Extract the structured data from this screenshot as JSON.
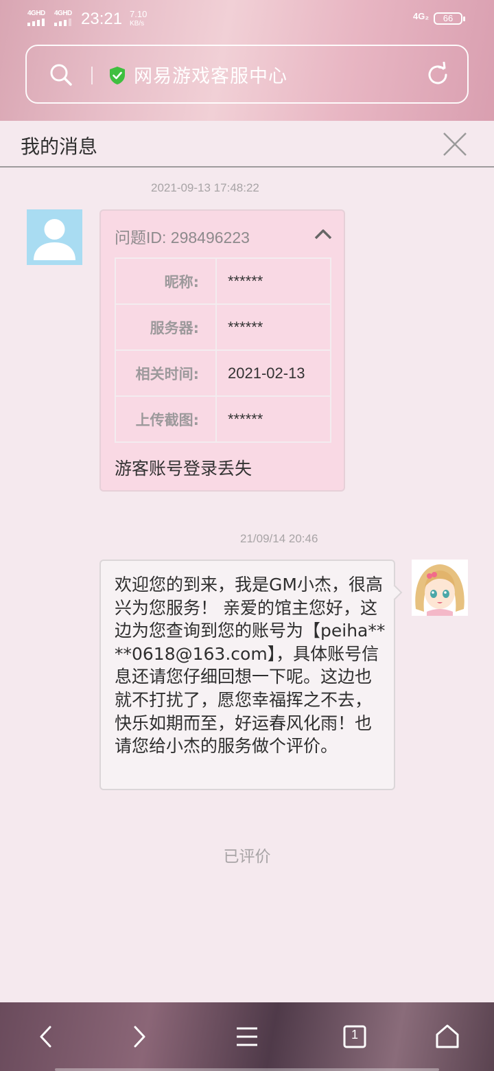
{
  "status_bar": {
    "sig1_label": "4GHD",
    "sig2_label": "4GHD",
    "time": "23:21",
    "speed_value": "7.10",
    "speed_unit": "KB/s",
    "network": "4G₂",
    "battery": "66"
  },
  "url_bar": {
    "site_title": "网易游戏客服中心",
    "secure_color": "#3fbf3f"
  },
  "panel": {
    "title": "我的消息"
  },
  "messages": {
    "ticket": {
      "timestamp": "2021-09-13 17:48:22",
      "header": "问题ID: 298496223",
      "rows": [
        {
          "label": "昵称:",
          "value": "******"
        },
        {
          "label": "服务器:",
          "value": "******"
        },
        {
          "label": "相关时间:",
          "value": "2021-02-13"
        },
        {
          "label": "上传截图:",
          "value": "******"
        }
      ],
      "footer": "游客账号登录丢失"
    },
    "reply": {
      "timestamp": "21/09/14 20:46",
      "text": "欢迎您的到来，我是GM小杰，很高兴为您服务！ 亲爱的馆主您好，这边为您查询到您的账号为【peiha****0618@163.com】，具体账号信息还请您仔细回想一下呢。这边也就不打扰了，愿您幸福挥之不去，快乐如期而至，好运春风化雨！也请您给小杰的服务做个评价。"
    },
    "rated_label": "已评价"
  },
  "bottom_nav": {
    "tab_count": "1"
  }
}
